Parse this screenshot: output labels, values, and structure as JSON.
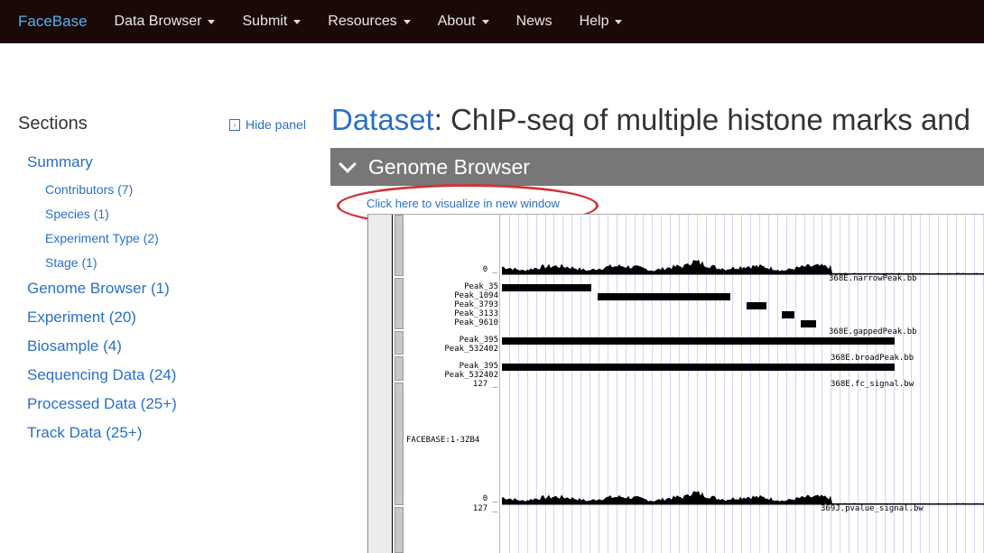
{
  "nav": {
    "brand": "FaceBase",
    "items": [
      {
        "label": "Data Browser",
        "caret": true
      },
      {
        "label": "Submit",
        "caret": true
      },
      {
        "label": "Resources",
        "caret": true
      },
      {
        "label": "About",
        "caret": true
      },
      {
        "label": "News",
        "caret": false
      },
      {
        "label": "Help",
        "caret": true
      }
    ]
  },
  "sidebar": {
    "title": "Sections",
    "hide_label": "Hide panel",
    "items": [
      {
        "label": "Summary",
        "level": 1
      },
      {
        "label": "Contributors (7)",
        "level": 2
      },
      {
        "label": "Species (1)",
        "level": 2
      },
      {
        "label": "Experiment Type (2)",
        "level": 2
      },
      {
        "label": "Stage (1)",
        "level": 2
      },
      {
        "label": "Genome Browser (1)",
        "level": 1
      },
      {
        "label": "Experiment (20)",
        "level": 1
      },
      {
        "label": "Biosample (4)",
        "level": 1
      },
      {
        "label": "Sequencing Data (24)",
        "level": 1
      },
      {
        "label": "Processed Data (25+)",
        "level": 1
      },
      {
        "label": "Track Data (25+)",
        "level": 1
      }
    ]
  },
  "main": {
    "title_prefix": "Dataset",
    "title_rest": ": ChIP-seq of multiple histone marks and",
    "section": "Genome Browser",
    "visualize_link": "Click here to visualize in new window"
  },
  "browser": {
    "narrow": {
      "zero": "0 _",
      "name": "368E.narrowPeak.bb"
    },
    "gapped": {
      "peaks": [
        "Peak_35",
        "Peak_1094",
        "Peak_3793",
        "Peak_3133",
        "Peak_9610"
      ],
      "name": "368E.gappedPeak.bb"
    },
    "broad1": {
      "peaks": [
        "Peak_395",
        "Peak_532402"
      ],
      "name": "368E.broadPeak.bb"
    },
    "broad2": {
      "peaks": [
        "Peak_395",
        "Peak_532402"
      ]
    },
    "fc": {
      "max": "127 _",
      "zero": "0 _",
      "name": "368E.fc_signal.bw"
    },
    "group_label": "FACEBASE:1-3ZB4",
    "pvalue": {
      "max": "127 _",
      "name": "369J.pvalue_signal.bw"
    }
  },
  "colors": {
    "nav_bg": "#1a0907",
    "brand": "#4fb3f0",
    "link": "#2a6fc9",
    "section_bar": "#777777",
    "highlight_ellipse": "#d0343a"
  }
}
